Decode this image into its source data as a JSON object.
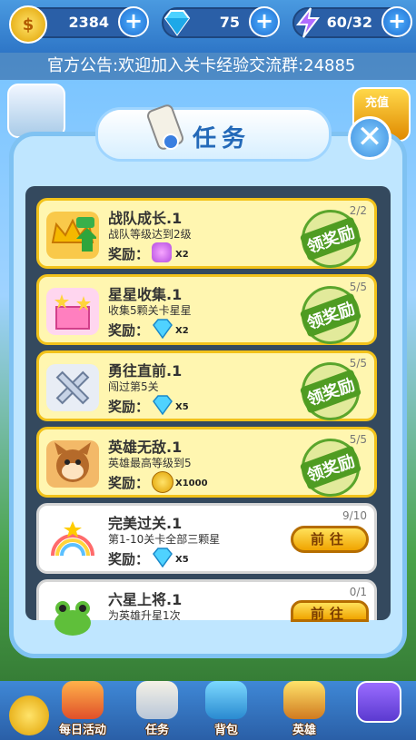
{
  "resources": {
    "gold": {
      "value": "2384",
      "icon": "gold-coin-icon"
    },
    "gems": {
      "value": "75",
      "icon": "diamond-icon"
    },
    "energy": {
      "value": "60/32",
      "icon": "lightning-icon"
    }
  },
  "announcement": "官方公告:欢迎加入关卡经验交流群:24885",
  "side": {
    "right_label": "充值"
  },
  "dialog": {
    "title": "任务",
    "close": "✕"
  },
  "tasks": [
    {
      "name": "战队成长.1",
      "desc": "战队等级达到2级",
      "reward_label": "奖励：",
      "reward_amount": "X2",
      "reward_icon": "potion-icon",
      "progress": "2/2",
      "action": "领奖励",
      "icon": "exp-crown-icon"
    },
    {
      "name": "星星收集.1",
      "desc": "收集5颗关卡星星",
      "reward_label": "奖励：",
      "reward_amount": "X2",
      "reward_icon": "diamond-icon",
      "progress": "5/5",
      "action": "领奖励",
      "icon": "star-gift-icon"
    },
    {
      "name": "勇往直前.1",
      "desc": "闯过第5关",
      "reward_label": "奖励：",
      "reward_amount": "X5",
      "reward_icon": "diamond-icon",
      "progress": "5/5",
      "action": "领奖励",
      "icon": "crossed-swords-icon"
    },
    {
      "name": "英雄无敌.1",
      "desc": "英雄最高等级到5",
      "reward_label": "奖励：",
      "reward_amount": "X1000",
      "reward_icon": "gold-coin-icon",
      "progress": "5/5",
      "action": "领奖励",
      "icon": "hero-face-icon"
    },
    {
      "name": "完美过关.1",
      "desc": "第1-10关卡全部三颗星",
      "reward_label": "奖励：",
      "reward_amount": "X5",
      "reward_icon": "diamond-icon",
      "progress": "9/10",
      "action": "前往",
      "icon": "rainbow-stars-icon"
    },
    {
      "name": "六星上将.1",
      "desc": "为英雄升星1次",
      "reward_label": "",
      "reward_amount": "",
      "reward_icon": "",
      "progress": "0/1",
      "action": "前往",
      "icon": "frog-icon"
    }
  ],
  "nav": [
    {
      "label": "",
      "icon": "gear-icon"
    },
    {
      "label": "每日活动",
      "icon": "gift-icon"
    },
    {
      "label": "任务",
      "icon": "scroll-icon"
    },
    {
      "label": "背包",
      "icon": "backpack-icon"
    },
    {
      "label": "英雄",
      "icon": "hero-icon"
    },
    {
      "label": "",
      "icon": "key-icon"
    }
  ]
}
